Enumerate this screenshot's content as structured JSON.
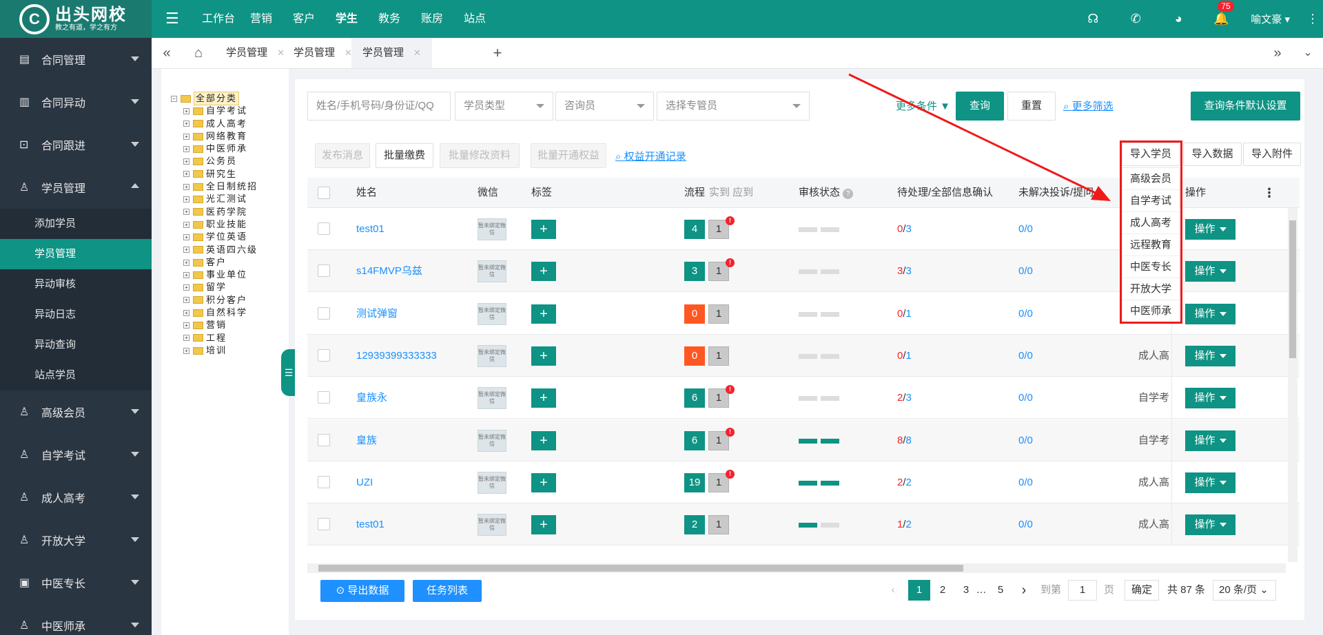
{
  "brand": {
    "name": "出头网校",
    "slogan": "教之有道，学之有方"
  },
  "topnav": [
    "工作台",
    "营销",
    "客户",
    "学生",
    "教务",
    "账房",
    "站点"
  ],
  "topnav_active": "学生",
  "notif_count": "75",
  "user_name": "喻文豪",
  "sidebar": {
    "groups_before": [
      {
        "label": "合同管理",
        "icon": "list-icon"
      },
      {
        "label": "合同异动",
        "icon": "doc-icon"
      },
      {
        "label": "合同跟进",
        "icon": "follow-icon"
      }
    ],
    "open_group": {
      "label": "学员管理",
      "icon": "user-icon"
    },
    "subitems": [
      "添加学员",
      "学员管理",
      "异动审核",
      "异动日志",
      "异动查询",
      "站点学员"
    ],
    "active_sub": "学员管理",
    "groups_after": [
      {
        "label": "高级会员",
        "icon": "user-icon"
      },
      {
        "label": "自学考试",
        "icon": "user-icon"
      },
      {
        "label": "成人高考",
        "icon": "user-icon"
      },
      {
        "label": "开放大学",
        "icon": "user-icon"
      },
      {
        "label": "中医专长",
        "icon": "id-icon"
      },
      {
        "label": "中医师承",
        "icon": "user-icon"
      }
    ]
  },
  "tabs": [
    "学员管理",
    "学员管理",
    "学员管理"
  ],
  "tree": {
    "root": "全部分类",
    "children": [
      "自学考试",
      "成人高考",
      "网络教育",
      "中医师承",
      "公务员",
      "研究生",
      "全日制统招",
      "光汇测试",
      "医药学院",
      "职业技能",
      "学位英语",
      "英语四六级",
      "客户",
      "事业单位",
      "留学",
      "积分客户",
      "自然科学",
      "营销",
      "工程",
      "培训"
    ]
  },
  "filters": {
    "search_placeholder": "姓名/手机号码/身份证/QQ",
    "student_type": "学员类型",
    "consultant": "咨询员",
    "manager": "选择专管员",
    "more_conditions": "更多条件",
    "query": "查询",
    "reset": "重置",
    "more_filter": "更多筛选",
    "default_settings": "查询条件默认设置"
  },
  "actions": {
    "publish": "发布消息",
    "batch_pay": "批量缴费",
    "batch_edit": "批量修改资料",
    "batch_open": "批量开通权益",
    "rights_log": "权益开通记录",
    "import_student": "导入学员",
    "import_data": "导入数据",
    "import_attach": "导入附件"
  },
  "import_menu": [
    "高级会员",
    "自学考试",
    "成人高考",
    "远程教育",
    "中医专长",
    "开放大学",
    "中医师承"
  ],
  "table": {
    "headers": {
      "name": "姓名",
      "wechat": "微信",
      "tag": "标签",
      "flow": "流程",
      "flow_sub": "实到 应到",
      "audit": "审核状态",
      "pending": "待处理/全部信息确认",
      "complaints": "未解决投诉/提问",
      "op": "操作"
    },
    "wechat_label": "暂未绑定微信",
    "op_label": "操作",
    "rows": [
      {
        "name": "test01",
        "flow_a": "4",
        "flow_color": "g",
        "flow_b": "1",
        "alert": true,
        "audit": "gy",
        "p1": "0",
        "p2": "3",
        "c1": "0",
        "c2": "0",
        "type": ""
      },
      {
        "name": "s14FMVP乌兹",
        "flow_a": "3",
        "flow_color": "g",
        "flow_b": "1",
        "alert": true,
        "audit": "gy",
        "p1": "3",
        "p2": "3",
        "c1": "0",
        "c2": "0",
        "type": ""
      },
      {
        "name": "测试弹窗",
        "flow_a": "0",
        "flow_color": "o",
        "flow_b": "1",
        "alert": false,
        "audit": "gy",
        "p1": "0",
        "p2": "1",
        "c1": "0",
        "c2": "0",
        "type": ""
      },
      {
        "name": "12939399333333",
        "flow_a": "0",
        "flow_color": "o",
        "flow_b": "1",
        "alert": false,
        "audit": "gy",
        "p1": "0",
        "p2": "1",
        "c1": "0",
        "c2": "0",
        "type": "成人高"
      },
      {
        "name": "皇族永",
        "flow_a": "6",
        "flow_color": "g",
        "flow_b": "1",
        "alert": true,
        "audit": "gy",
        "p1": "2",
        "p2": "3",
        "c1": "0",
        "c2": "0",
        "type": "自学考"
      },
      {
        "name": "皇族",
        "flow_a": "6",
        "flow_color": "g",
        "flow_b": "1",
        "alert": true,
        "audit": "gn",
        "p1": "8",
        "p2": "8",
        "c1": "0",
        "c2": "0",
        "type": "自学考"
      },
      {
        "name": "UZI",
        "flow_a": "19",
        "flow_color": "g",
        "flow_b": "1",
        "alert": true,
        "audit": "gn",
        "p1": "2",
        "p2": "2",
        "c1": "0",
        "c2": "0",
        "type": "成人高"
      },
      {
        "name": "test01",
        "flow_a": "2",
        "flow_color": "g",
        "flow_b": "1",
        "alert": false,
        "audit": "half",
        "p1": "1",
        "p2": "2",
        "c1": "0",
        "c2": "0",
        "type": "成人高"
      }
    ]
  },
  "footer": {
    "export": "导出数据",
    "tasks": "任务列表",
    "pages": [
      "1",
      "2",
      "3",
      "…",
      "5"
    ],
    "current_page": "1",
    "goto_label": "到第",
    "goto_value": "1",
    "page_unit": "页",
    "confirm": "确定",
    "total": "共 87 条",
    "page_size": "20 条/页"
  },
  "colors": {
    "primary": "#0e9384",
    "sidebar": "#2a3542",
    "link": "#1890ff",
    "danger": "#f5222d",
    "orange": "#ff5722"
  }
}
